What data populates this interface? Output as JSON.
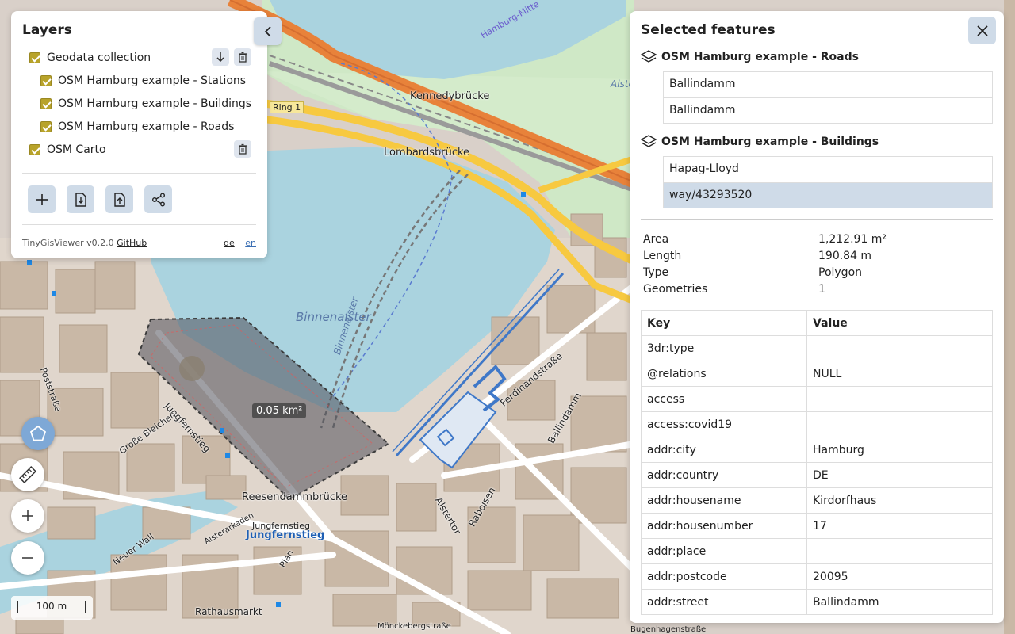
{
  "map": {
    "labels": {
      "kennedy": "Kennedybrücke",
      "lombards": "Lombardsbrücke",
      "binnenalster": "Binnenalster",
      "binnenalster_line": "Binnenalster",
      "jungfernstieg": "Jungfernstieg",
      "jungfernstieg_stop": "Jungfernstieg",
      "jungfernstieg_station": "Jungfernstieg",
      "reesendamm": "Reesendammbrücke",
      "ferdinand": "Ferdinandstraße",
      "ballindamm": "Ballindamm",
      "alstertor": "Alstertor",
      "raboisen": "Raboisen",
      "rathaus": "Rathausmarkt",
      "moenckeberg": "Mönckebergstraße",
      "bugenhagen": "Bugenhagenstraße",
      "grosse_bleichen": "Große Bleichen",
      "neuer_wall": "Neuer Wall",
      "poststrasse": "Poststraße",
      "ring1": "Ring 1",
      "alsterarkaden": "Alsterarkaden",
      "plan": "Plan",
      "alster_top": "Alster",
      "hamburg_mitte": "Hamburg-Mitte"
    },
    "measurement": "0.05 km²",
    "scale": "100 m"
  },
  "layers": {
    "title": "Layers",
    "items": [
      {
        "label": "Geodata collection",
        "checked": true
      },
      {
        "label": "OSM Hamburg example - Stations",
        "checked": true
      },
      {
        "label": "OSM Hamburg example - Buildings",
        "checked": true
      },
      {
        "label": "OSM Hamburg example - Roads",
        "checked": true
      },
      {
        "label": "OSM Carto",
        "checked": true
      }
    ],
    "footer": {
      "version": "TinyGisViewer v0.2.0",
      "github": "GitHub",
      "lang_de": "de",
      "lang_en": "en"
    }
  },
  "features": {
    "title": "Selected features",
    "groups": [
      {
        "title": "OSM Hamburg example - Roads",
        "items": [
          "Ballindamm",
          "Ballindamm"
        ]
      },
      {
        "title": "OSM Hamburg example - Buildings",
        "items": [
          "Hapag-Lloyd",
          "way/43293520"
        ]
      }
    ],
    "stats": [
      {
        "key": "Area",
        "value": "1,212.91 m²"
      },
      {
        "key": "Length",
        "value": "190.84 m"
      },
      {
        "key": "Type",
        "value": "Polygon"
      },
      {
        "key": "Geometries",
        "value": "1"
      }
    ],
    "table": {
      "key_header": "Key",
      "value_header": "Value",
      "rows": [
        {
          "key": "3dr:type",
          "value": ""
        },
        {
          "key": "@relations",
          "value": "NULL"
        },
        {
          "key": "access",
          "value": ""
        },
        {
          "key": "access:covid19",
          "value": ""
        },
        {
          "key": "addr:city",
          "value": "Hamburg"
        },
        {
          "key": "addr:country",
          "value": "DE"
        },
        {
          "key": "addr:housename",
          "value": "Kirdorfhaus"
        },
        {
          "key": "addr:housenumber",
          "value": "17"
        },
        {
          "key": "addr:place",
          "value": ""
        },
        {
          "key": "addr:postcode",
          "value": "20095"
        },
        {
          "key": "addr:street",
          "value": "Ballindamm"
        }
      ]
    }
  },
  "colors": {
    "water": "#aad3df",
    "park": "#c8e6c0",
    "building": "#c9b8a6",
    "motorway": "#e8823a",
    "trunk": "#f7c940",
    "accent": "#cfdbe8",
    "checkbox": "#b8a32a",
    "selection": "#5a6470"
  }
}
